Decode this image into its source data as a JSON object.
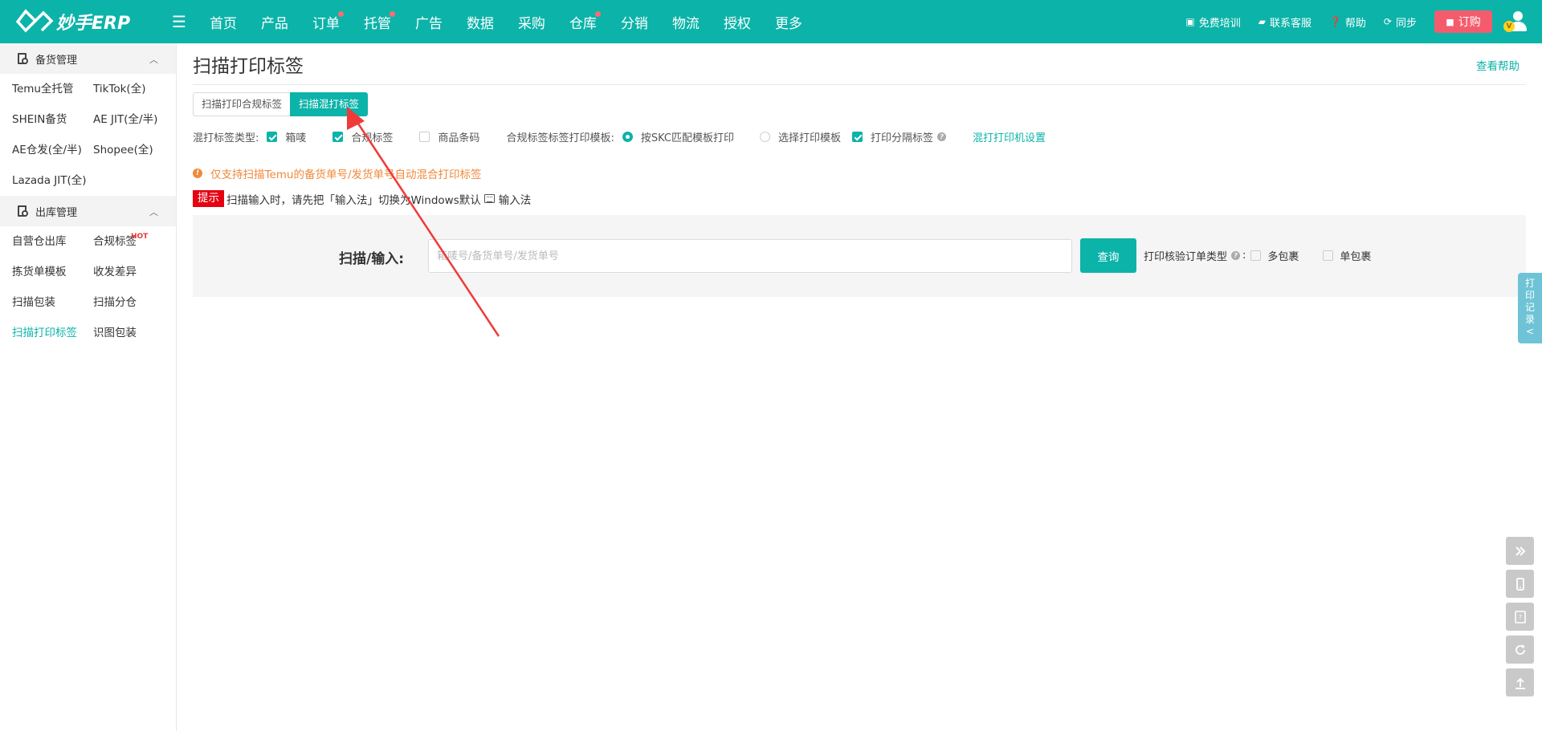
{
  "brand": {
    "name": "妙手ERP"
  },
  "nav": {
    "items": [
      {
        "label": "首页",
        "dot": false
      },
      {
        "label": "产品",
        "dot": false
      },
      {
        "label": "订单",
        "dot": true
      },
      {
        "label": "托管",
        "dot": true
      },
      {
        "label": "广告",
        "dot": false
      },
      {
        "label": "数据",
        "dot": false
      },
      {
        "label": "采购",
        "dot": false
      },
      {
        "label": "仓库",
        "dot": true
      },
      {
        "label": "分销",
        "dot": false
      },
      {
        "label": "物流",
        "dot": false
      },
      {
        "label": "授权",
        "dot": false
      },
      {
        "label": "更多",
        "dot": false
      }
    ],
    "right": {
      "training": "免费培训",
      "service": "联系客服",
      "help": "帮助",
      "sync": "同步",
      "order": "订购",
      "vip": "V"
    }
  },
  "sidebar": {
    "section1": {
      "title": "备货管理",
      "items": [
        "Temu全托管",
        "TikTok(全)",
        "SHEIN备货",
        "AE JIT(全/半)",
        "AE仓发(全/半)",
        "Shopee(全)",
        "Lazada JIT(全)"
      ]
    },
    "section2": {
      "title": "出库管理",
      "items": [
        "自营仓出库",
        "合规标签",
        "拣货单模板",
        "收发差异",
        "扫描包装",
        "扫描分仓",
        "扫描打印标签",
        "识图包装"
      ],
      "hot": "HOT",
      "active": "扫描打印标签"
    }
  },
  "page": {
    "title": "扫描打印标签",
    "help": "查看帮助",
    "tabs": [
      "扫描打印合规标签",
      "扫描混打标签"
    ],
    "active_tab": "扫描混打标签",
    "options": {
      "type_label": "混打标签类型:",
      "types": [
        {
          "label": "箱唛",
          "checked": true
        },
        {
          "label": "合规标签",
          "checked": true
        },
        {
          "label": "商品条码",
          "checked": false
        }
      ],
      "template_label": "合规标签标签打印模板:",
      "templates": [
        {
          "label": "按SKC匹配模板打印",
          "selected": true
        },
        {
          "label": "选择打印模板",
          "selected": false
        }
      ],
      "separator": {
        "label": "打印分隔标签",
        "checked": true
      },
      "printer_link": "混打打印机设置"
    },
    "warning": "仅支持扫描Temu的备货单号/发货单号自动混合打印标签",
    "tip": {
      "badge": "提示",
      "text": "扫描输入时，请先把「输入法」切换为Windows默认",
      "suffix": "输入法"
    },
    "scan": {
      "label": "扫描/输入:",
      "placeholder": "箱唛号/备货单号/发货单号",
      "value": "",
      "button": "查询",
      "verify_label": "打印核验订单类型",
      "colon": ":",
      "options": [
        {
          "label": "多包裹",
          "checked": false
        },
        {
          "label": "单包裹",
          "checked": false
        }
      ]
    }
  },
  "print_record": [
    "打",
    "印",
    "记",
    "录",
    "<"
  ],
  "colors": {
    "primary": "#0cb3a9",
    "warning": "#f0893b",
    "danger": "#e60012",
    "order": "#f45c6e"
  }
}
